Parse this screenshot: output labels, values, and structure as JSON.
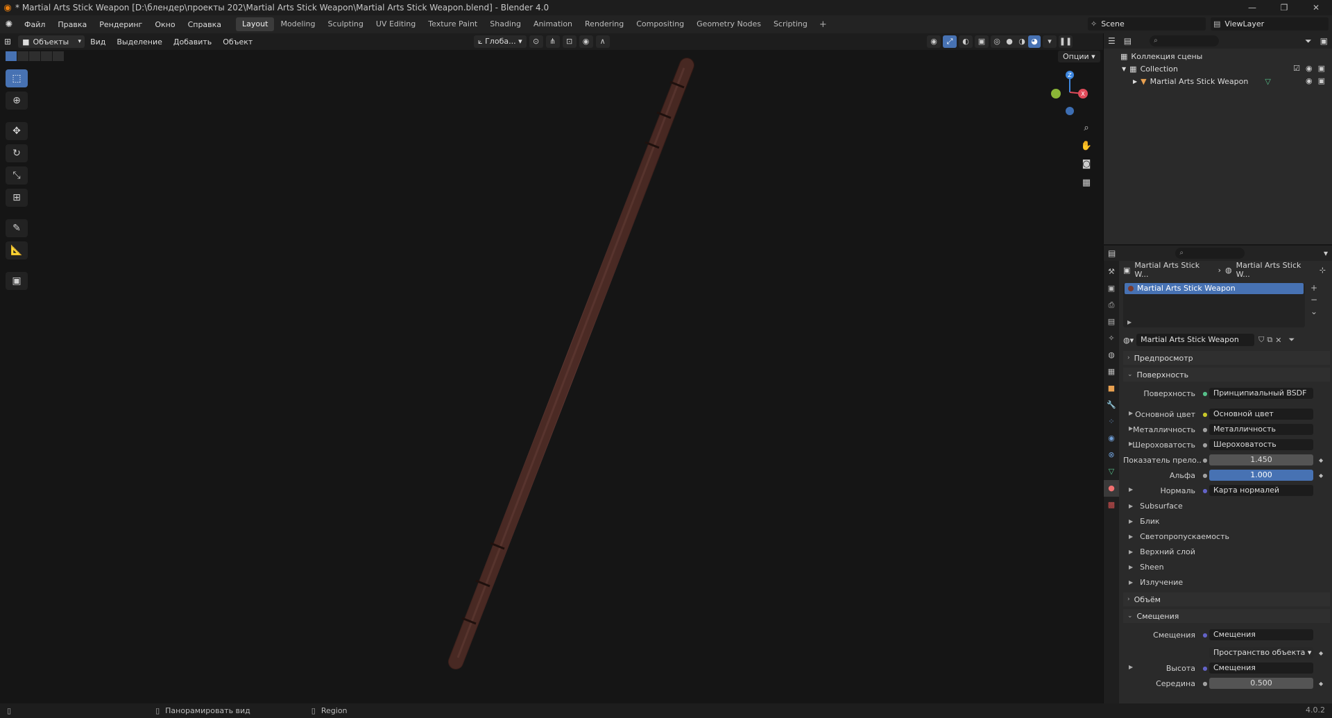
{
  "window": {
    "title": "* Martial Arts Stick Weapon [D:\\блендер\\проекты 202\\Martial Arts Stick Weapon\\Martial Arts Stick Weapon.blend] - Blender 4.0",
    "controls": [
      "—",
      "❐",
      "✕"
    ]
  },
  "menubar": {
    "menus": [
      "Файл",
      "Правка",
      "Рендеринг",
      "Окно",
      "Справка"
    ],
    "workspaces": [
      "Layout",
      "Modeling",
      "Sculpting",
      "UV Editing",
      "Texture Paint",
      "Shading",
      "Animation",
      "Rendering",
      "Compositing",
      "Geometry Nodes",
      "Scripting"
    ],
    "active_workspace": "Layout",
    "scene": "Scene",
    "view_layer": "ViewLayer"
  },
  "viewport_header": {
    "mode": "Объекты",
    "menus": [
      "Вид",
      "Выделение",
      "Добавить",
      "Объект"
    ],
    "transform_orientation": "Глоба...",
    "options": "Опции"
  },
  "toolbar": {
    "tools": [
      "select-box",
      "cursor",
      "move",
      "rotate",
      "scale",
      "transform",
      "annotate",
      "measure",
      "add-cube"
    ],
    "active": "select-box"
  },
  "outliner": {
    "root": "Коллекция сцены",
    "collection": "Collection",
    "object": "Martial Arts Stick Weapon"
  },
  "properties": {
    "breadcrumb_object": "Martial Arts Stick W...",
    "breadcrumb_material": "Martial Arts Stick W...",
    "material_slot": "Martial Arts Stick Weapon",
    "material_name": "Martial Arts Stick Weapon",
    "panels": {
      "preview": "Предпросмотр",
      "surface": "Поверхность",
      "volume": "Объём",
      "displacement": "Смещения"
    },
    "surface": {
      "shader_label": "Поверхность",
      "shader_value": "Принципиальный BSDF",
      "rows": [
        {
          "label": "Основной цвет",
          "value": "Основной цвет",
          "socket": "#c7c729"
        },
        {
          "label": "Металличность",
          "value": "Металличность",
          "socket": "#a1a1a1"
        },
        {
          "label": "Шероховатость",
          "value": "Шероховатость",
          "socket": "#a1a1a1"
        }
      ],
      "ior_label": "Показатель прело...",
      "ior_value": "1.450",
      "alpha_label": "Альфа",
      "alpha_value": "1.000",
      "normal_label": "Нормаль",
      "normal_value": "Карта нормалей",
      "subpanels": [
        "Subsurface",
        "Блик",
        "Светопропускаемость",
        "Верхний слой",
        "Sheen",
        "Излучение"
      ]
    },
    "displacement": {
      "label": "Смещения",
      "value": "Смещения",
      "space": "Пространство объекта",
      "height_label": "Высота",
      "height_value": "Смещения",
      "midlevel_label": "Середина",
      "midlevel_value": "0.500"
    }
  },
  "statusbar": {
    "hint1": "Панорамировать вид",
    "hint2": "Region",
    "version": "4.0.2"
  },
  "colors": {
    "accent": "#4772b3",
    "stick": "#4a2a24",
    "axis_x": "#e04b5a",
    "axis_y": "#8ab637",
    "axis_z": "#3d87e0"
  }
}
